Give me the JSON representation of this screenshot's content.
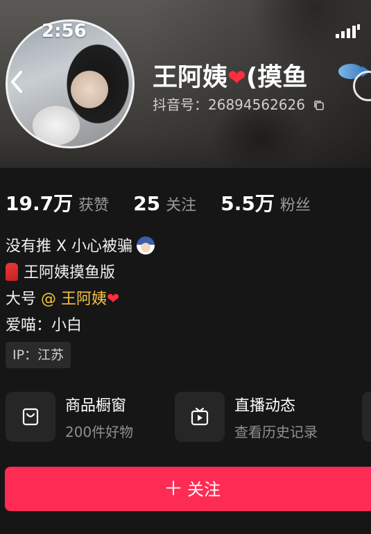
{
  "status_bar": {
    "time": "2:56"
  },
  "profile": {
    "name": "王阿姨",
    "name_suffix": "(摸鱼",
    "douyin_id": "抖音号：26894562626"
  },
  "stats": [
    {
      "num": "19.7万",
      "label": "获赞"
    },
    {
      "num": "25",
      "label": "关注"
    },
    {
      "num": "5.5万",
      "label": "粉丝"
    }
  ],
  "bio": {
    "line1": "没有推 X 小心被骗",
    "line2": "王阿姨摸鱼版",
    "line3_prefix": "大号 ",
    "line3_mention": "@ 王阿姨",
    "line4": "爱喵：小白"
  },
  "ip": "IP：江苏",
  "cards": [
    {
      "title": "商品橱窗",
      "subtitle": "200件好物",
      "icon": "bag-icon"
    },
    {
      "title": "直播动态",
      "subtitle": "查看历史记录",
      "icon": "tv-icon"
    }
  ],
  "follow_button": {
    "plus": "＋",
    "label": "关注"
  },
  "colors": {
    "accent": "#fe2c55",
    "mention": "#f4c542",
    "background": "#161616"
  }
}
